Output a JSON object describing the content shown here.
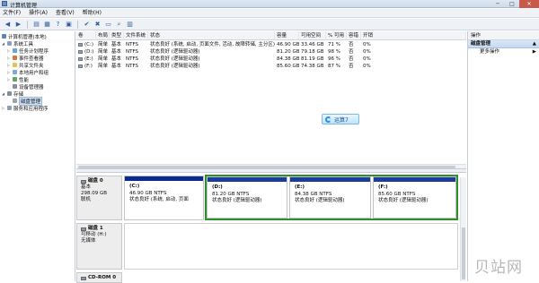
{
  "window": {
    "title": "计算机管理",
    "min": "─",
    "max": "□",
    "close": "✕"
  },
  "menu": [
    "文件(F)",
    "操作(A)",
    "查看(V)",
    "帮助(H)"
  ],
  "tree": {
    "root": "计算机管理(本地)",
    "system_tools": "系统工具",
    "task_scheduler": "任务计划程序",
    "event_viewer": "事件查看器",
    "shared_folders": "共享文件夹",
    "local_users": "本地用户和组",
    "performance": "性能",
    "device_manager": "设备管理器",
    "storage": "存储",
    "disk_management": "磁盘管理",
    "services": "服务和应用程序"
  },
  "volume_table": {
    "headers": [
      "卷",
      "布局",
      "类型",
      "文件系统",
      "状态",
      "容量",
      "可用空间",
      "% 可用",
      "容错",
      "开销"
    ],
    "rows": [
      [
        "(C:)",
        "简单",
        "基本",
        "NTFS",
        "状态良好 (系统, 启动, 页面文件, 活动, 故障转储, 主分区)",
        "46.90 GB",
        "33.46 GB",
        "71 %",
        "否",
        "0%"
      ],
      [
        "(D:)",
        "简单",
        "基本",
        "NTFS",
        "状态良好 (逻辑驱动器)",
        "81.20 GB",
        "79.18 GB",
        "98 %",
        "否",
        "0%"
      ],
      [
        "(E:)",
        "简单",
        "基本",
        "NTFS",
        "状态良好 (逻辑驱动器)",
        "84.38 GB",
        "81.19 GB",
        "96 %",
        "否",
        "0%"
      ],
      [
        "(F:)",
        "简单",
        "基本",
        "NTFS",
        "状态良好 (逻辑驱动器)",
        "85.60 GB",
        "74.38 GB",
        "87 %",
        "否",
        "0%"
      ]
    ]
  },
  "splash": {
    "text": "运算7"
  },
  "disks": [
    {
      "name": "磁盘 0",
      "type": "基本",
      "size": "298.09 GB",
      "status": "联机",
      "partitions": [
        {
          "letter": "(C:)",
          "size": "46.90 GB NTFS",
          "status": "状态良好 (系统, 启动, 页面"
        },
        {
          "letter": "(D:)",
          "size": "81.20 GB NTFS",
          "status": "状态良好 (逻辑驱动器)"
        },
        {
          "letter": "(E:)",
          "size": "84.38 GB NTFS",
          "status": "状态良好 (逻辑驱动器)"
        },
        {
          "letter": "(F:)",
          "size": "85.60 GB NTFS",
          "status": "状态良好 (逻辑驱动器)"
        }
      ]
    },
    {
      "name": "磁盘 1",
      "type": "可移动 (H:)",
      "size": "",
      "status": "无媒体"
    },
    {
      "name": "CD-ROM 0",
      "type": "",
      "size": "",
      "status": ""
    }
  ],
  "actions": {
    "header": "操作",
    "section": "磁盘管理",
    "more": "更多操作",
    "arrow": "▲",
    "more_arrow": "▶"
  },
  "watermark": "贝站网",
  "colors": {
    "primary_bar": "#0a2a8f",
    "extended_border": "#2f8f2f",
    "close": "#c85a4a"
  }
}
